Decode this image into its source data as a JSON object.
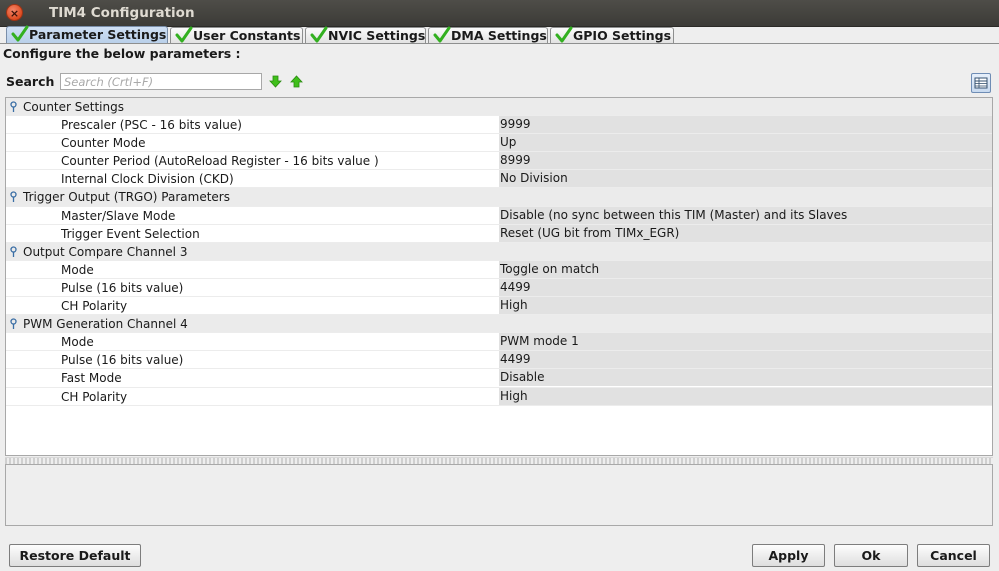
{
  "window": {
    "title": "TIM4 Configuration",
    "close_glyph": "×"
  },
  "tabs": [
    {
      "label": "Parameter Settings",
      "active": true
    },
    {
      "label": "User Constants",
      "active": false
    },
    {
      "label": "NVIC Settings",
      "active": false
    },
    {
      "label": "DMA Settings",
      "active": false
    },
    {
      "label": "GPIO Settings",
      "active": false
    }
  ],
  "configure_label": "Configure the below parameters :",
  "search": {
    "label": "Search :",
    "placeholder": "Search (Crtl+F)",
    "value": ""
  },
  "icons": {
    "tab_check": "check-icon",
    "search_down": "arrow-down-icon",
    "search_up": "arrow-up-icon",
    "view_toggle": "table-view-icon",
    "group": "expand-pin-icon",
    "accent_green": "#3fbf1a",
    "check_green": "#33b020"
  },
  "groups": [
    {
      "label": "Counter Settings",
      "params": [
        {
          "name": "Prescaler (PSC - 16 bits value)",
          "value": "9999"
        },
        {
          "name": "Counter Mode",
          "value": "Up"
        },
        {
          "name": "Counter Period (AutoReload Register - 16 bits value )",
          "value": "8999"
        },
        {
          "name": "Internal Clock Division (CKD)",
          "value": "No Division"
        }
      ]
    },
    {
      "label": "Trigger Output (TRGO) Parameters",
      "params": [
        {
          "name": "Master/Slave Mode",
          "value": "Disable (no sync between this TIM (Master) and its Slaves"
        },
        {
          "name": "Trigger Event Selection",
          "value": "Reset (UG bit from TIMx_EGR)"
        }
      ]
    },
    {
      "label": "Output Compare Channel 3",
      "params": [
        {
          "name": "Mode",
          "value": "Toggle on match"
        },
        {
          "name": "Pulse (16 bits value)",
          "value": "4499"
        },
        {
          "name": "CH Polarity",
          "value": "High"
        }
      ]
    },
    {
      "label": "PWM Generation Channel 4",
      "params": [
        {
          "name": "Mode",
          "value": "PWM mode 1"
        },
        {
          "name": "Pulse (16 bits value)",
          "value": "4499"
        },
        {
          "name": "Fast Mode",
          "value": "Disable"
        },
        {
          "name": "CH Polarity",
          "value": "High"
        }
      ]
    }
  ],
  "buttons": {
    "restore_default": "Restore Default",
    "apply": "Apply",
    "ok": "Ok",
    "cancel": "Cancel"
  }
}
